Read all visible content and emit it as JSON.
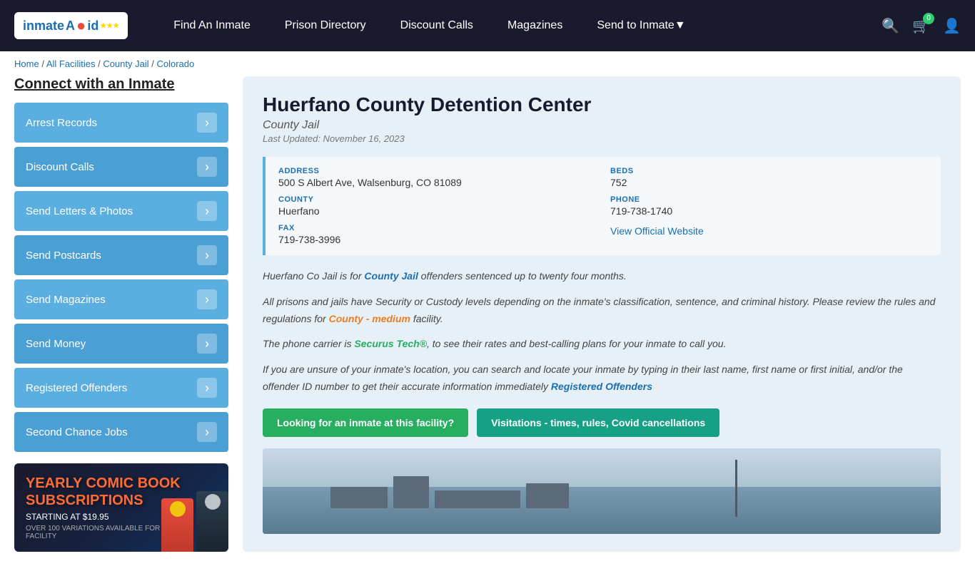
{
  "navbar": {
    "logo": "inmateAid",
    "nav_items": [
      {
        "label": "Find An Inmate",
        "id": "find-inmate"
      },
      {
        "label": "Prison Directory",
        "id": "prison-directory"
      },
      {
        "label": "Discount Calls",
        "id": "discount-calls"
      },
      {
        "label": "Magazines",
        "id": "magazines"
      },
      {
        "label": "Send to Inmate",
        "id": "send-to-inmate",
        "has_dropdown": true
      }
    ],
    "cart_count": "0"
  },
  "breadcrumb": {
    "items": [
      {
        "label": "Home",
        "href": "#"
      },
      {
        "label": "All Facilities",
        "href": "#"
      },
      {
        "label": "County Jail",
        "href": "#"
      },
      {
        "label": "Colorado",
        "href": "#"
      }
    ]
  },
  "sidebar": {
    "title": "Connect with an Inmate",
    "items": [
      {
        "label": "Arrest Records",
        "id": "arrest-records"
      },
      {
        "label": "Discount Calls",
        "id": "discount-calls"
      },
      {
        "label": "Send Letters & Photos",
        "id": "send-letters"
      },
      {
        "label": "Send Postcards",
        "id": "send-postcards"
      },
      {
        "label": "Send Magazines",
        "id": "send-magazines"
      },
      {
        "label": "Send Money",
        "id": "send-money"
      },
      {
        "label": "Registered Offenders",
        "id": "registered-offenders"
      },
      {
        "label": "Second Chance Jobs",
        "id": "second-chance-jobs"
      }
    ],
    "ad": {
      "title_line1": "YEARLY COMIC BOOK",
      "title_line2": "SUBSCRIPTIONS",
      "subtitle": "STARTING AT $19.95",
      "bottom": "OVER 100 VARIATIONS AVAILABLE FOR EVERY FACILITY"
    }
  },
  "facility": {
    "title": "Huerfano County Detention Center",
    "type": "County Jail",
    "last_updated": "Last Updated: November 16, 2023",
    "address_label": "ADDRESS",
    "address_value": "500 S Albert Ave, Walsenburg, CO 81089",
    "beds_label": "BEDS",
    "beds_value": "752",
    "county_label": "COUNTY",
    "county_value": "Huerfano",
    "phone_label": "PHONE",
    "phone_value": "719-738-1740",
    "fax_label": "FAX",
    "fax_value": "719-738-3996",
    "website_label": "View Official Website",
    "website_href": "#",
    "description_p1": "Huerfano Co Jail is for County Jail offenders sentenced up to twenty four months.",
    "description_p2": "All prisons and jails have Security or Custody levels depending on the inmate's classification, sentence, and criminal history. Please review the rules and regulations for County - medium facility.",
    "description_p3": "The phone carrier is Securus Tech®, to see their rates and best-calling plans for your inmate to call you.",
    "description_p4": "If you are unsure of your inmate's location, you can search and locate your inmate by typing in their last name, first name or first initial, and/or the offender ID number to get their accurate information immediately Registered Offenders",
    "btn1_label": "Looking for an inmate at this facility?",
    "btn2_label": "Visitations - times, rules, Covid cancellations"
  }
}
